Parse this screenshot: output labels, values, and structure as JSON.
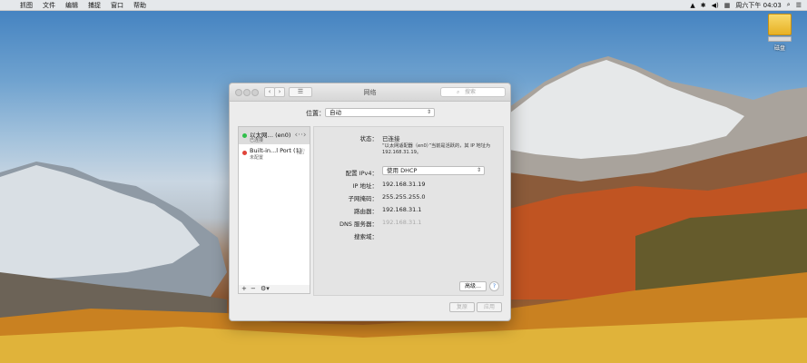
{
  "menubar": {
    "apple_glyph": "",
    "items": [
      "抓图",
      "文件",
      "编辑",
      "捕捉",
      "窗口",
      "帮助"
    ],
    "status": {
      "clock": "周六下午 04:03"
    }
  },
  "desktop": {
    "drive_label": "磁盘"
  },
  "window": {
    "title": "网络",
    "search_placeholder": "搜索",
    "nav": {
      "back": "‹",
      "forward": "›",
      "grid": "☰"
    },
    "location": {
      "label": "位置：",
      "value": "自动"
    },
    "services": [
      {
        "name": "以太网… (en0)",
        "status": "已连接",
        "dot_color": "#2fbf4a"
      },
      {
        "name": "Built-in...l Port (1)",
        "status": "未配置",
        "dot_color": "#e0443a"
      }
    ],
    "sidebar_tools": {
      "add": "+",
      "remove": "−",
      "gear": "⚙▾"
    },
    "detail": {
      "status_label": "状态：",
      "status_value": "已连接",
      "status_note": "“以太网适配器（en0）”当前是活跃的，其 IP 地址为 192.168.31.19。",
      "config_label": "配置 IPv4：",
      "config_value": "使用 DHCP",
      "ip_label": "IP 地址：",
      "ip_value": "192.168.31.19",
      "mask_label": "子网掩码：",
      "mask_value": "255.255.255.0",
      "router_label": "路由器：",
      "router_value": "192.168.31.1",
      "dns_label": "DNS 服务器：",
      "dns_value": "192.168.31.1",
      "search_domain_label": "搜索域：",
      "advanced_button": "高级…",
      "help_button": "?"
    },
    "footer": {
      "revert": "复原",
      "apply": "应用"
    }
  },
  "colors": {
    "selected_row": "#dcdcdc",
    "connected": "#2fbf4a",
    "not_configured": "#e0443a"
  }
}
